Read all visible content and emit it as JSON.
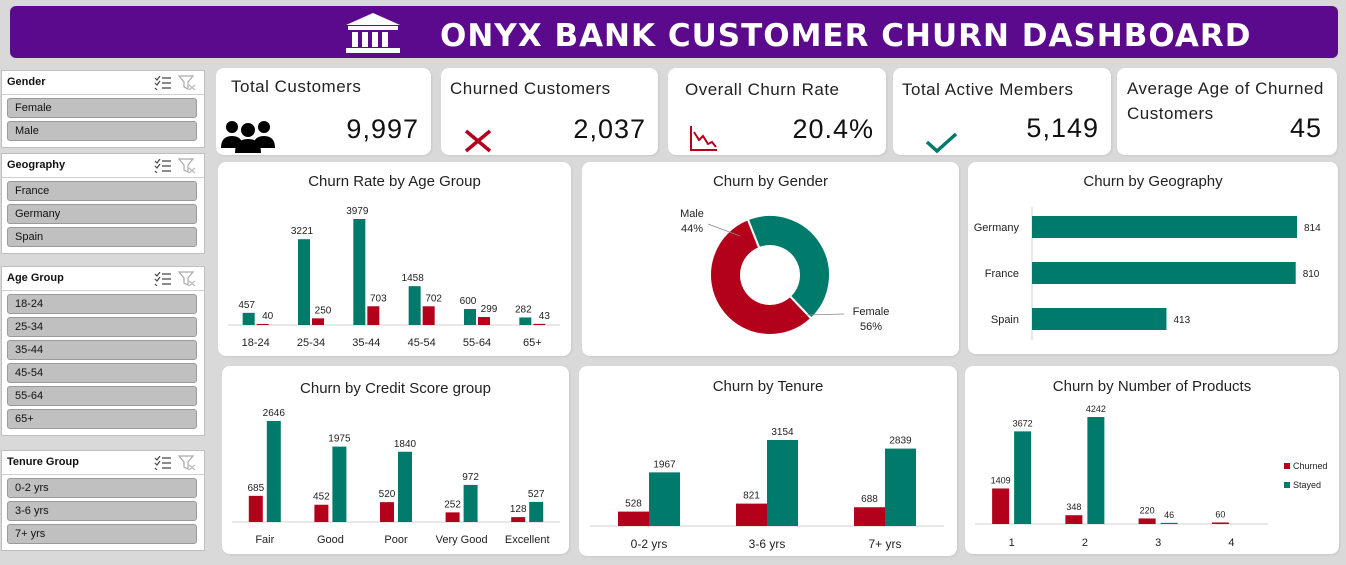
{
  "banner": {
    "title": "ONYX BANK CUSTOMER CHURN DASHBOARD"
  },
  "colors": {
    "teal": "#007a6a",
    "red": "#b3001b",
    "purple": "#5b0a8e",
    "axis": "#cfcfcf"
  },
  "slicers": [
    {
      "title": "Gender",
      "items": [
        "Female",
        "Male"
      ]
    },
    {
      "title": "Geography",
      "items": [
        "France",
        "Germany",
        "Spain"
      ]
    },
    {
      "title": "Age Group",
      "items": [
        "18-24",
        "25-34",
        "35-44",
        "45-54",
        "55-64",
        "65+"
      ]
    },
    {
      "title": "Tenure Group",
      "items": [
        "0-2 yrs",
        "3-6 yrs",
        "7+ yrs"
      ]
    }
  ],
  "kpis": {
    "total_customers": {
      "label": "Total Customers",
      "value": "9,997",
      "icon": "people-icon"
    },
    "churned_customers": {
      "label": "Churned Customers",
      "value": "2,037",
      "icon": "x-icon"
    },
    "churn_rate": {
      "label": "Overall Churn Rate",
      "value": "20.4%",
      "icon": "decline-chart-icon"
    },
    "active_members": {
      "label": "Total Active Members",
      "value": "5,149",
      "icon": "check-icon"
    },
    "avg_age": {
      "label": "Average Age of Churned Customers",
      "value": "45"
    }
  },
  "chart_data": [
    {
      "id": "age",
      "type": "bar",
      "title": "Churn Rate by Age Group",
      "categories": [
        "18-24",
        "25-34",
        "35-44",
        "45-54",
        "55-64",
        "65+"
      ],
      "series": [
        {
          "values": [
            457,
            3221,
            3979,
            1458,
            600,
            282
          ],
          "color": "#007a6a"
        },
        {
          "values": [
            40,
            250,
            703,
            702,
            299,
            43
          ],
          "color": "#b3001b"
        }
      ]
    },
    {
      "id": "gender",
      "type": "pie",
      "title": "Churn by Gender",
      "slices": [
        {
          "name": "Male",
          "value": 44,
          "label": "44%",
          "color": "#007a6a"
        },
        {
          "name": "Female",
          "value": 56,
          "label": "56%",
          "color": "#b3001b"
        }
      ]
    },
    {
      "id": "geo",
      "type": "bar",
      "orientation": "horizontal",
      "title": "Churn by Geography",
      "categories": [
        "Germany",
        "France",
        "Spain"
      ],
      "values": [
        814,
        810,
        413
      ]
    },
    {
      "id": "credit",
      "type": "bar",
      "title": "Churn by Credit Score group",
      "categories": [
        "Fair",
        "Good",
        "Poor",
        "Very Good",
        "Excellent"
      ],
      "series": [
        {
          "values": [
            685,
            452,
            520,
            252,
            128
          ],
          "color": "#b3001b"
        },
        {
          "values": [
            2646,
            1975,
            1840,
            972,
            527
          ],
          "color": "#007a6a"
        }
      ]
    },
    {
      "id": "tenure",
      "type": "bar",
      "title": "Churn by Tenure",
      "categories": [
        "0-2 yrs",
        "3-6 yrs",
        "7+ yrs"
      ],
      "series": [
        {
          "values": [
            528,
            821,
            688
          ],
          "color": "#b3001b"
        },
        {
          "values": [
            1967,
            3154,
            2839
          ],
          "color": "#007a6a"
        }
      ]
    },
    {
      "id": "products",
      "type": "bar",
      "title": "Churn by Number of Products",
      "categories": [
        "1",
        "2",
        "3",
        "4"
      ],
      "series": [
        {
          "name": "Churned",
          "values": [
            1409,
            348,
            220,
            60
          ],
          "color": "#b3001b"
        },
        {
          "name": "Stayed",
          "values": [
            3672,
            4242,
            46,
            null
          ],
          "color": "#007a6a"
        }
      ],
      "legend": "right"
    }
  ]
}
